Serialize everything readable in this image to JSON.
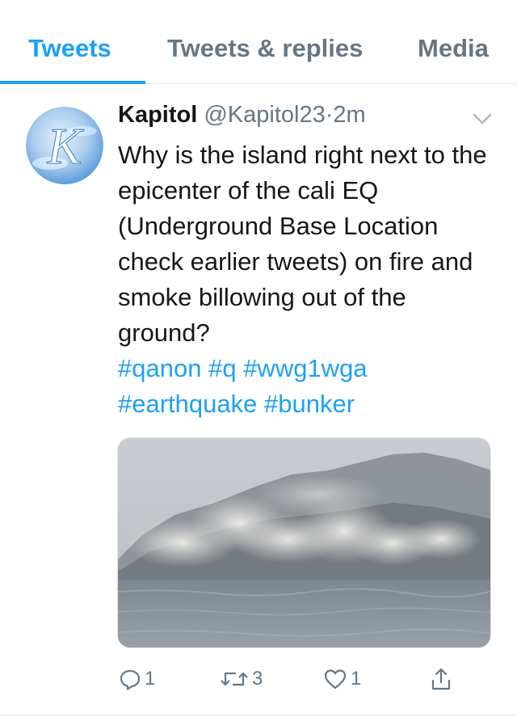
{
  "tabs": [
    {
      "label": "Tweets",
      "active": true
    },
    {
      "label": "Tweets & replies",
      "active": false
    },
    {
      "label": "Media",
      "active": false
    }
  ],
  "tweet": {
    "author_name": "Kapitol",
    "handle": "@Kapitol23",
    "separator": "·",
    "time": "2m",
    "text": "Why is the island right next to the epicenter of the cali EQ (Underground Base Location check earlier tweets) on fire and smoke billowing out of the ground?",
    "hashtags": [
      "#qanon",
      "#q",
      "#wwg1wga",
      "#earthquake",
      "#bunker"
    ],
    "avatar_letter": "K",
    "media": "photo of smoke billowing over a hilly island coastline"
  },
  "actions": {
    "reply_count": "1",
    "retweet_count": "3",
    "like_count": "1"
  },
  "colors": {
    "accent": "#1da1f2",
    "secondary_text": "#657786",
    "primary_text": "#14171a",
    "border": "#e1e8ed"
  },
  "icons": [
    "chevron-down-icon",
    "reply-icon",
    "retweet-icon",
    "like-icon",
    "share-icon"
  ]
}
